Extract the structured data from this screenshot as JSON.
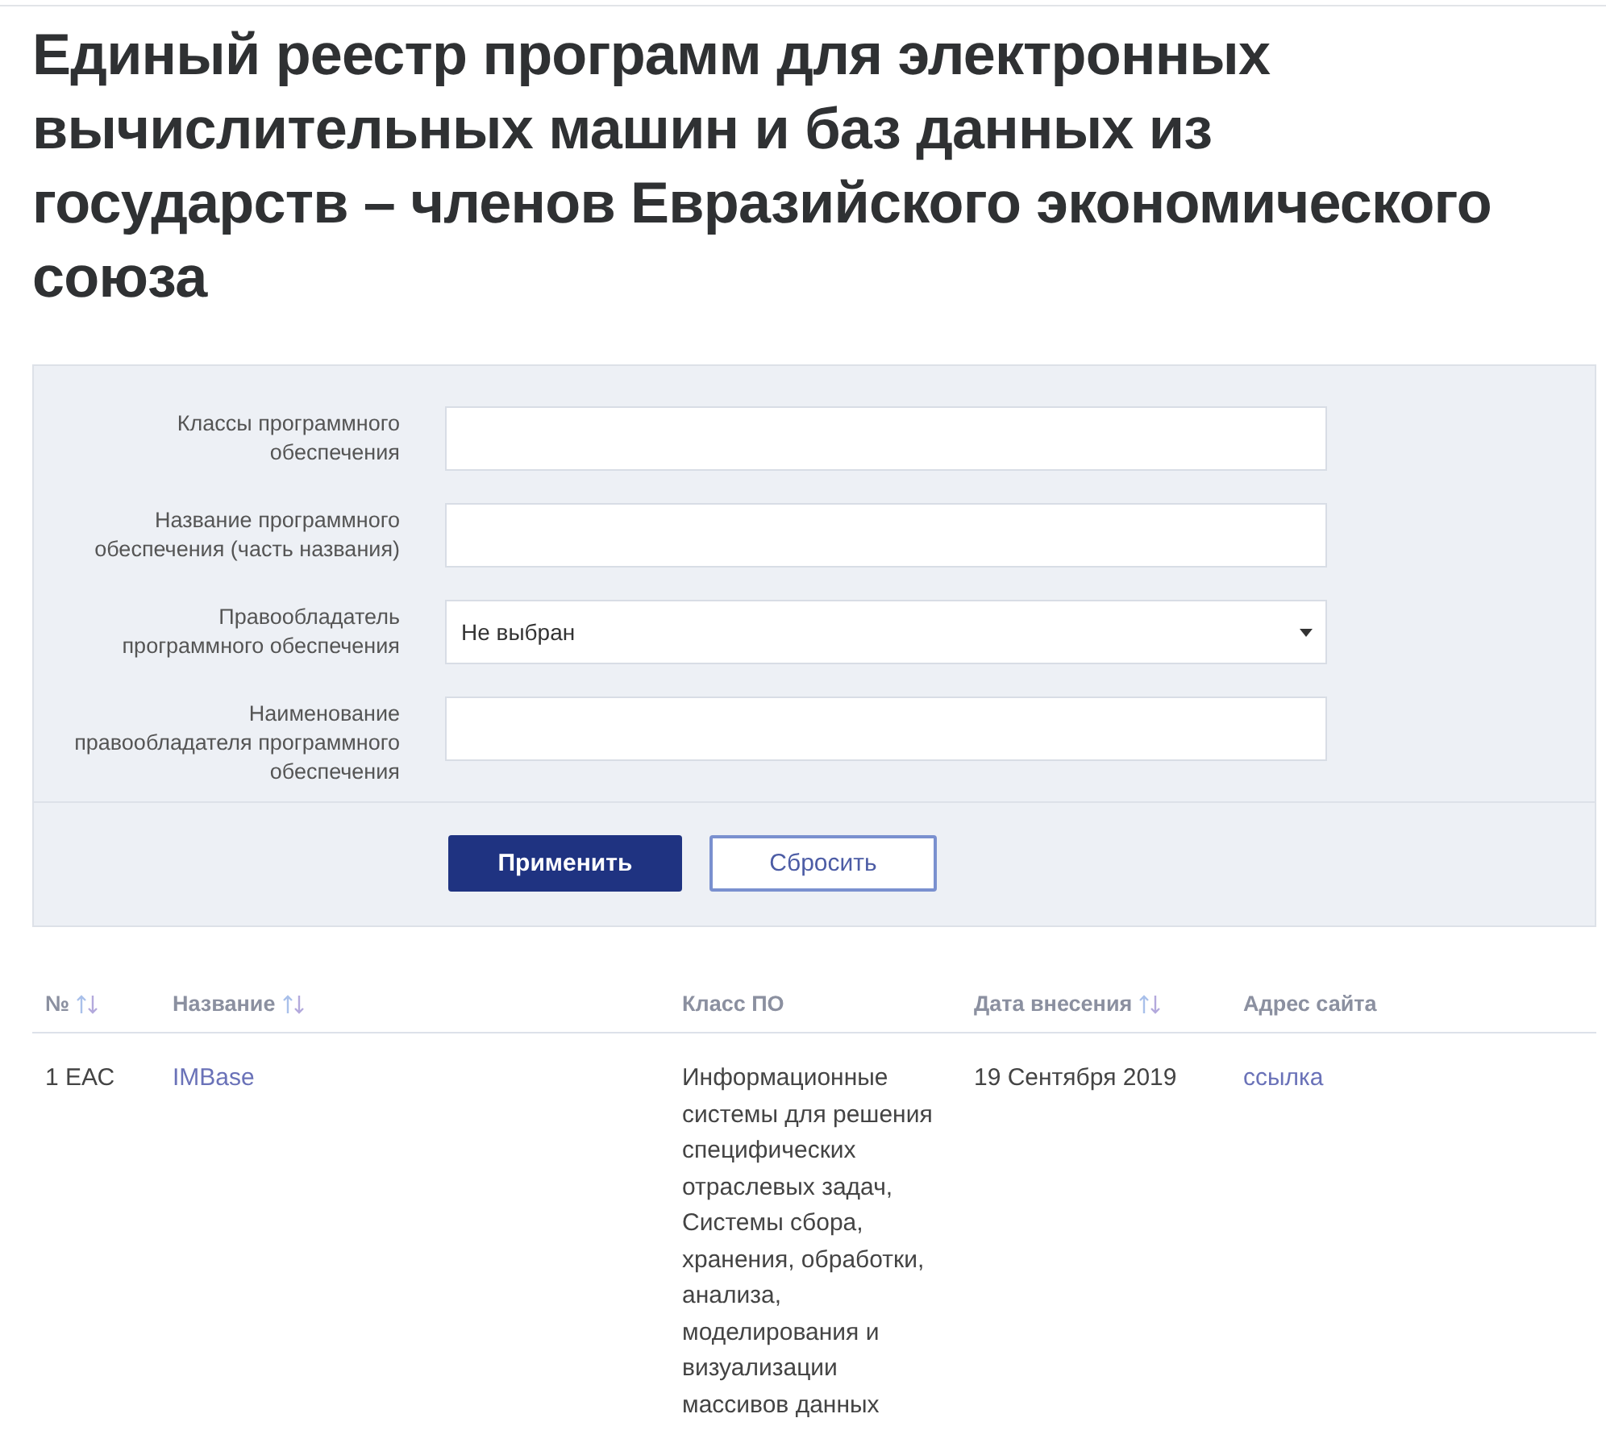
{
  "title": "Единый реестр программ для электронных вычислительных машин и баз данных из государств – членов Евразийского экономического союза",
  "filter": {
    "fields": [
      {
        "kind": "text",
        "label": "Классы программного\nобеспечения"
      },
      {
        "kind": "text",
        "label": "Название программного\nобеспечения (часть названия)"
      },
      {
        "kind": "select",
        "label": "Правообладатель\nпрограммного обеспечения",
        "value": "Не выбран"
      },
      {
        "kind": "text",
        "label": "Наименование\nправообладателя программного\nобеспечения"
      }
    ],
    "buttons": [
      {
        "kind": "submit",
        "label": "Применить"
      },
      {
        "kind": "reset",
        "label": "Сбросить"
      }
    ]
  },
  "table": {
    "columns": [
      {
        "label": "№",
        "sortable": true
      },
      {
        "label": "Название",
        "sortable": true
      },
      {
        "label": "Класс ПО",
        "sortable": false
      },
      {
        "label": "Дата внесения",
        "sortable": true
      },
      {
        "label": "Адрес сайта",
        "sortable": false
      }
    ],
    "rows": [
      {
        "cells": [
          {
            "kind": "text",
            "text": "1 ЕАС"
          },
          {
            "kind": "link",
            "text": "IMBase"
          },
          {
            "kind": "text",
            "text": "Информационные системы для решения специфических отраслевых задач, Системы сбора, хранения, обработки, анализа, моделирования и визуализации массивов данных"
          },
          {
            "kind": "text",
            "text": "19 Сентября 2019"
          },
          {
            "kind": "link",
            "text": "ссылка"
          }
        ]
      }
    ]
  }
}
